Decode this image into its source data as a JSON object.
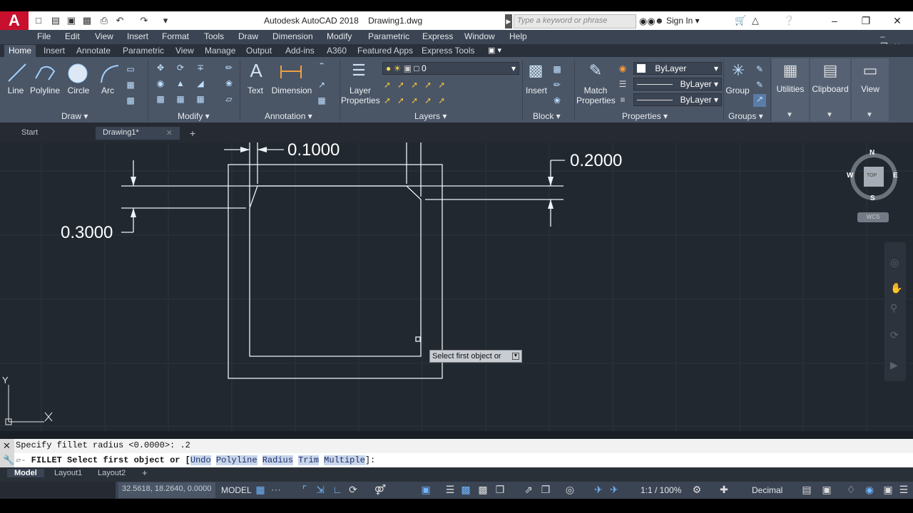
{
  "app": {
    "logo_letter": "A",
    "title": "Autodesk AutoCAD 2018    Drawing1.dwg",
    "search_placeholder": "Type a keyword or phrase",
    "sign_in": "Sign In"
  },
  "menubar": [
    "File",
    "Edit",
    "View",
    "Insert",
    "Format",
    "Tools",
    "Draw",
    "Dimension",
    "Modify",
    "Parametric",
    "Express",
    "Window",
    "Help"
  ],
  "ribbon_tabs": [
    "Home",
    "Insert",
    "Annotate",
    "Parametric",
    "View",
    "Manage",
    "Output",
    "Add-ins",
    "A360",
    "Featured Apps",
    "Express Tools"
  ],
  "ribbon_active_tab": "Home",
  "draw_panel": {
    "title": "Draw",
    "tools": [
      "Line",
      "Polyline",
      "Circle",
      "Arc"
    ]
  },
  "modify_panel": {
    "title": "Modify"
  },
  "annotation_panel": {
    "title": "Annotation",
    "tools": [
      "Text",
      "Dimension"
    ]
  },
  "layers_panel": {
    "title": "Layers",
    "tool": "Layer Properties",
    "current_layer": "0"
  },
  "block_panel": {
    "title": "Block",
    "tool": "Insert"
  },
  "properties_panel": {
    "title": "Properties",
    "tool": "Match Properties",
    "color": "ByLayer",
    "linetype": "ByLayer",
    "lineweight": "ByLayer"
  },
  "groups_panel": {
    "title": "Groups",
    "tool": "Group"
  },
  "right_tools": [
    "Utilities",
    "Clipboard",
    "View"
  ],
  "doc_tabs": {
    "start": "Start",
    "drawing": "Drawing1*",
    "new_tab": "+"
  },
  "drawing": {
    "dim_top": "0.1000",
    "dim_right": "0.2000",
    "dim_left": "0.3000",
    "tooltip": "Select first object or",
    "viewcube": {
      "n": "N",
      "s": "S",
      "e": "E",
      "w": "W",
      "top": "TOP",
      "wcs": "WCS"
    },
    "ucs": {
      "x": "X",
      "y": "Y"
    }
  },
  "command": {
    "history": "Specify fillet radius <0.0000>: .2",
    "prefix": "FILLET Select first object or [",
    "options": [
      "Undo",
      "Polyline",
      "Radius",
      "Trim",
      "Multiple"
    ],
    "suffix": "]:"
  },
  "layout_tabs": [
    "Model",
    "Layout1",
    "Layout2",
    "+"
  ],
  "status": {
    "coords": "32.5618, 18.2640, 0.0000",
    "space": "MODEL",
    "scale": "1:1 / 100%",
    "units": "Decimal"
  }
}
